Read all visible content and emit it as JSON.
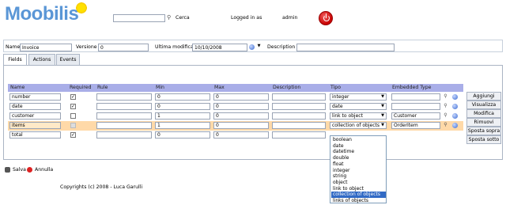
{
  "app": {
    "logo": "Moobilis"
  },
  "top": {
    "search_label": "Cerca",
    "logged_label": "Logged in as",
    "user": "admin"
  },
  "form": {
    "name_label": "Name",
    "name_value": "Invoice",
    "version_label": "Versione",
    "version_value": "0",
    "modified_label": "Ultima modifica",
    "modified_value": "10/10/2008",
    "desc_label": "Description",
    "desc_value": ""
  },
  "tabs": [
    "Fields",
    "Actions",
    "Events"
  ],
  "columns": [
    "Name",
    "Required",
    "Rule",
    "Min",
    "Max",
    "Description",
    "Tipo",
    "Embedded Type"
  ],
  "rows": [
    {
      "name": "number",
      "required": true,
      "rule": "",
      "min": "0",
      "max": "0",
      "desc": "",
      "tipo": "integer",
      "embedded": ""
    },
    {
      "name": "date",
      "required": true,
      "rule": "",
      "min": "0",
      "max": "0",
      "desc": "",
      "tipo": "date",
      "embedded": ""
    },
    {
      "name": "customer",
      "required": false,
      "rule": "",
      "min": "1",
      "max": "0",
      "desc": "",
      "tipo": "link to object",
      "embedded": "Customer"
    },
    {
      "name": "items",
      "required": false,
      "rule": "",
      "min": "1",
      "max": "0",
      "desc": "",
      "tipo": "collection of objects",
      "embedded": "OrderItem"
    },
    {
      "name": "total",
      "required": true,
      "rule": "",
      "min": "0",
      "max": "0",
      "desc": "",
      "tipo": "",
      "embedded": ""
    }
  ],
  "buttons": [
    "Aggiungi",
    "Visualizza",
    "Modifica",
    "Rimuovi",
    "Sposta sopra",
    "Sposta sotto"
  ],
  "dropdown": [
    "boolean",
    "date",
    "datetime",
    "double",
    "float",
    "integer",
    "string",
    "object",
    "link to object",
    "collection of objects",
    "links of objects"
  ],
  "dropdown_selected": "collection of objects",
  "footer": {
    "save": "Salva",
    "cancel": "Annulla",
    "copyright": "Copyrights (c) 2008 - Luca Garulli"
  }
}
